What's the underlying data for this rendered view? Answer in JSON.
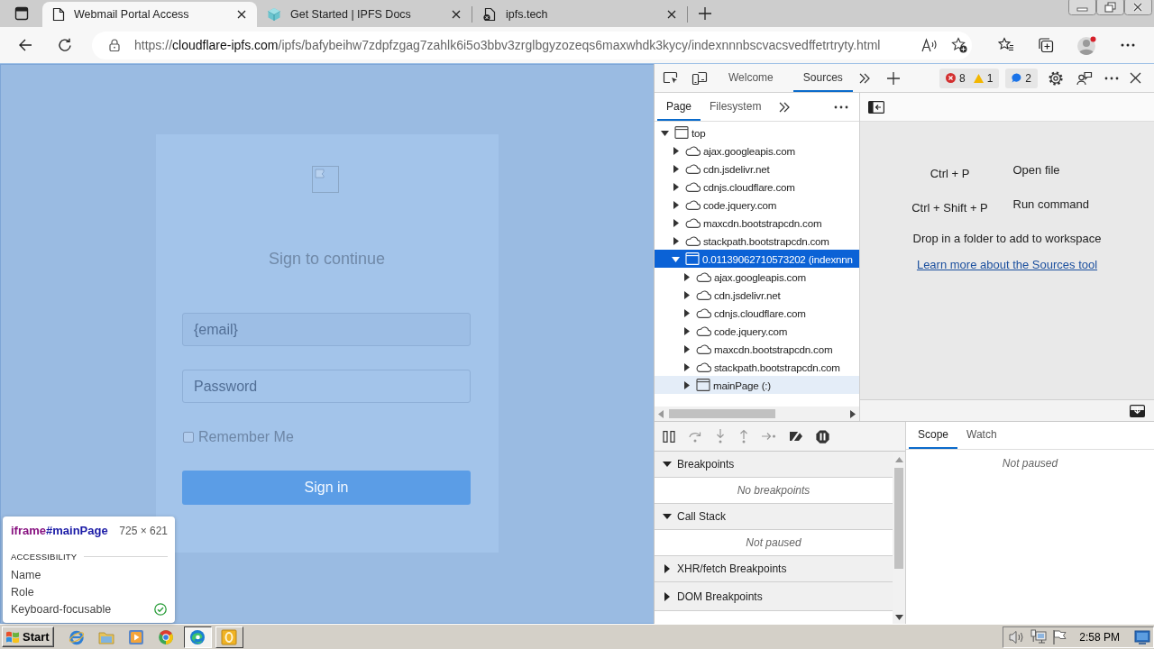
{
  "browser": {
    "tabs": [
      {
        "title": "Webmail Portal Access",
        "selected": true
      },
      {
        "title": "Get Started | IPFS Docs",
        "selected": false
      },
      {
        "title": "ipfs.tech",
        "selected": false
      }
    ],
    "address_bar": {
      "scheme": "https://",
      "host": "cloudflare-ipfs.com",
      "path": "/ipfs/bafybeihw7zdpfzgag7zahlk6i5o3bbv3zrglbgyzozeqs6maxwhdk3kycy/indexnnnbscvacsvedffetrtryty.html"
    }
  },
  "page": {
    "title": "Sign to continue",
    "email_field": {
      "placeholder": "{email}"
    },
    "password_field": {
      "placeholder": "Password"
    },
    "remember_me": {
      "label": "Remember Me",
      "checked": false
    },
    "sign_in_button": "Sign in"
  },
  "inspect_tooltip": {
    "tag": "iframe",
    "id": "#mainPage",
    "size": "725 × 621",
    "section": "ACCESSIBILITY",
    "rows": [
      {
        "label": "Name",
        "checked": false
      },
      {
        "label": "Role",
        "checked": false
      },
      {
        "label": "Keyboard-focusable",
        "checked": true
      }
    ]
  },
  "devtools": {
    "tabs": [
      {
        "label": "Welcome",
        "selected": false
      },
      {
        "label": "Sources",
        "selected": true
      }
    ],
    "issue_counts": {
      "errors": "8",
      "warnings": "1",
      "messages": "2"
    },
    "navigator": {
      "tabs": [
        {
          "label": "Page",
          "selected": true
        },
        {
          "label": "Filesystem",
          "selected": false
        }
      ],
      "tree": [
        {
          "label": "top",
          "kind": "frame",
          "expanded": true,
          "selected": false,
          "hovered": false,
          "children": [
            {
              "label": "ajax.googleapis.com",
              "kind": "origin",
              "expanded": false,
              "selected": false,
              "hovered": false
            },
            {
              "label": "cdn.jsdelivr.net",
              "kind": "origin",
              "expanded": false,
              "selected": false,
              "hovered": false
            },
            {
              "label": "cdnjs.cloudflare.com",
              "kind": "origin",
              "expanded": false,
              "selected": false,
              "hovered": false
            },
            {
              "label": "code.jquery.com",
              "kind": "origin",
              "expanded": false,
              "selected": false,
              "hovered": false
            },
            {
              "label": "maxcdn.bootstrapcdn.com",
              "kind": "origin",
              "expanded": false,
              "selected": false,
              "hovered": false
            },
            {
              "label": "stackpath.bootstrapcdn.com",
              "kind": "origin",
              "expanded": false,
              "selected": false,
              "hovered": false
            },
            {
              "label": "0.01139062710573202 (indexnnn",
              "kind": "frame",
              "expanded": true,
              "selected": true,
              "hovered": false,
              "children": [
                {
                  "label": "ajax.googleapis.com",
                  "kind": "origin",
                  "expanded": false,
                  "selected": false,
                  "hovered": false
                },
                {
                  "label": "cdn.jsdelivr.net",
                  "kind": "origin",
                  "expanded": false,
                  "selected": false,
                  "hovered": false
                },
                {
                  "label": "cdnjs.cloudflare.com",
                  "kind": "origin",
                  "expanded": false,
                  "selected": false,
                  "hovered": false
                },
                {
                  "label": "code.jquery.com",
                  "kind": "origin",
                  "expanded": false,
                  "selected": false,
                  "hovered": false
                },
                {
                  "label": "maxcdn.bootstrapcdn.com",
                  "kind": "origin",
                  "expanded": false,
                  "selected": false,
                  "hovered": false
                },
                {
                  "label": "stackpath.bootstrapcdn.com",
                  "kind": "origin",
                  "expanded": false,
                  "selected": false,
                  "hovered": false
                },
                {
                  "label": "mainPage (:)",
                  "kind": "frame",
                  "expanded": false,
                  "selected": false,
                  "hovered": true
                }
              ]
            }
          ]
        }
      ]
    },
    "editor": {
      "shortcuts": [
        {
          "keys": "Ctrl + P",
          "action": "Open file"
        },
        {
          "keys": "Ctrl + Shift + P",
          "action": "Run command"
        }
      ],
      "drop_hint": "Drop in a folder to add to workspace",
      "link": "Learn more about the Sources tool"
    },
    "debugger": {
      "sections": [
        {
          "title": "Breakpoints",
          "expanded": true,
          "message": "No breakpoints"
        },
        {
          "title": "Call Stack",
          "expanded": true,
          "message": "Not paused"
        },
        {
          "title": "XHR/fetch Breakpoints",
          "expanded": false
        },
        {
          "title": "DOM Breakpoints",
          "expanded": false
        }
      ]
    },
    "sidebar": {
      "tabs": [
        {
          "label": "Scope",
          "selected": true
        },
        {
          "label": "Watch",
          "selected": false
        }
      ],
      "message": "Not paused"
    }
  },
  "taskbar": {
    "start": "Start",
    "tasks": [
      {
        "selected": true
      },
      {
        "selected": false
      }
    ],
    "clock": "2:58 PM"
  }
}
